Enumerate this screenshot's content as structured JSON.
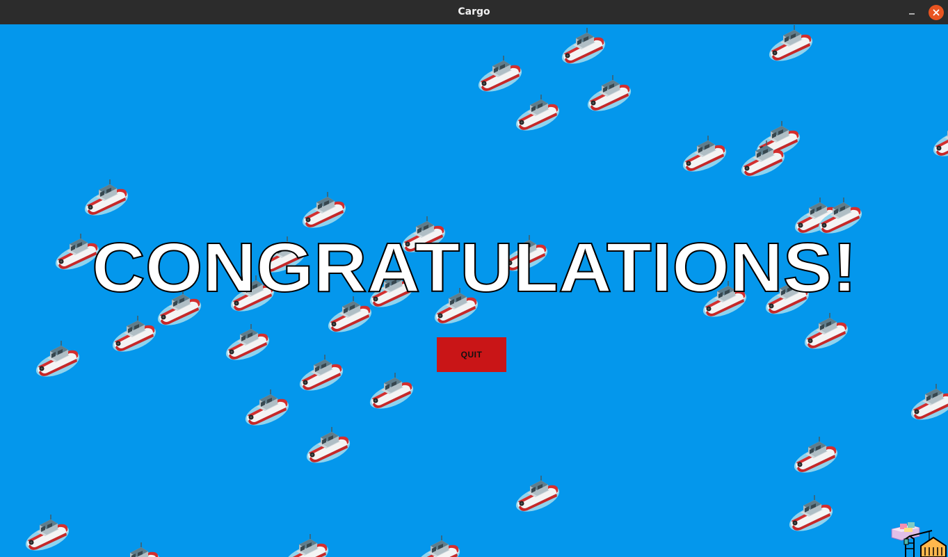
{
  "window": {
    "title": "Cargo",
    "minimize_icon": "minimize-icon",
    "close_icon": "close-icon"
  },
  "game": {
    "background_color": "#0497ec",
    "heading": "CONGRATULATIONS!",
    "heading_fill": "#ffffff",
    "heading_stroke": "#000000",
    "quit_button": {
      "label": "QUIT",
      "color": "#c91517"
    },
    "sprite_icon": "tugboat-icon",
    "logo_icon": "cargo-port-logo-icon"
  }
}
